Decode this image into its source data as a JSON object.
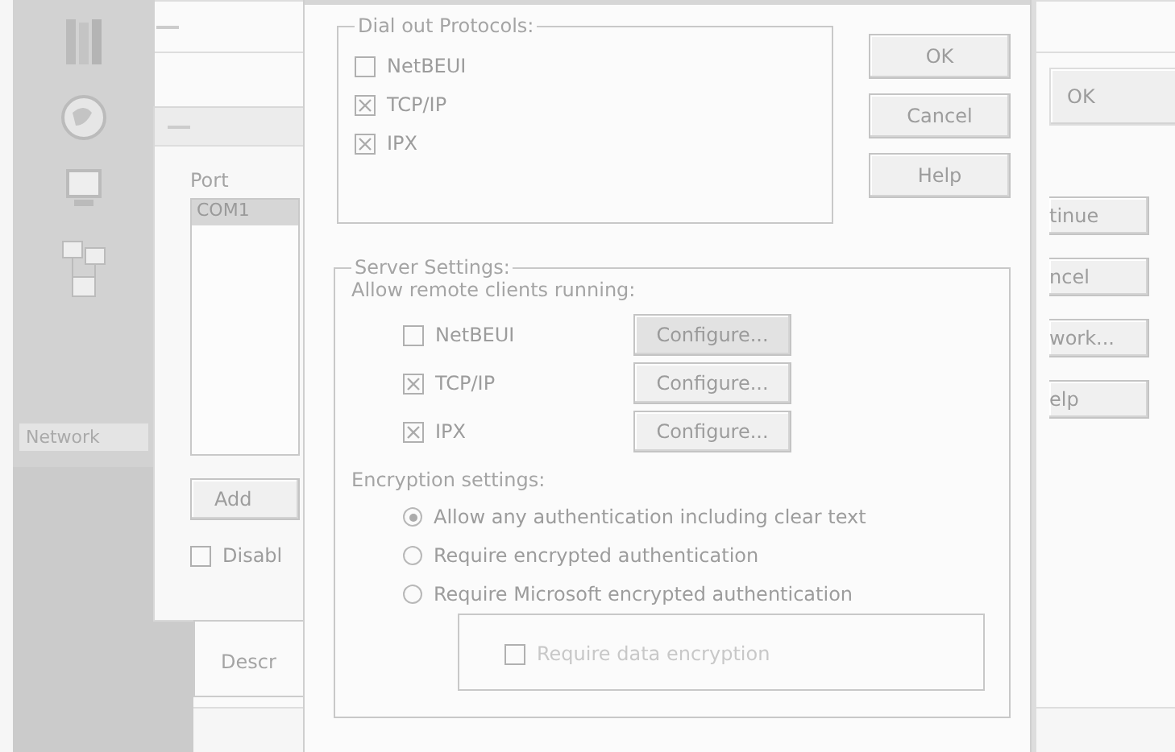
{
  "desktop": {
    "icon_label": "Network"
  },
  "back_window": {
    "button": "OK",
    "side_buttons": [
      "tinue",
      "ncel",
      "work...",
      "elp"
    ]
  },
  "port_window": {
    "column": "Port",
    "rows": [
      {
        "text": "COM1",
        "selected": true
      }
    ],
    "add_button": "Add",
    "checkbox": {
      "label": "Disabl",
      "checked": false
    },
    "description": "Descr"
  },
  "dialog": {
    "dial_out": {
      "title": "Dial out Protocols:",
      "protocols": [
        {
          "label": "NetBEUI",
          "checked": false
        },
        {
          "label": "TCP/IP",
          "checked": true
        },
        {
          "label": "IPX",
          "checked": true
        }
      ]
    },
    "buttons": [
      "OK",
      "Cancel",
      "Help"
    ],
    "server": {
      "title": "Server Settings:",
      "prompt": "Allow remote clients running:",
      "protocols": [
        {
          "label": "NetBEUI",
          "checked": false,
          "button": "Configure...",
          "disabled": true
        },
        {
          "label": "TCP/IP",
          "checked": true,
          "button": "Configure...",
          "disabled": false
        },
        {
          "label": "IPX",
          "checked": true,
          "button": "Configure...",
          "disabled": false
        }
      ]
    },
    "encryption": {
      "title": "Encryption settings:",
      "options": [
        {
          "label": "Allow any authentication including clear text",
          "selected": true
        },
        {
          "label": "Require encrypted authentication",
          "selected": false
        },
        {
          "label": "Require Microsoft encrypted authentication",
          "selected": false
        }
      ],
      "data_encryption": {
        "label": "Require data encryption",
        "checked": false,
        "disabled": true
      }
    }
  }
}
